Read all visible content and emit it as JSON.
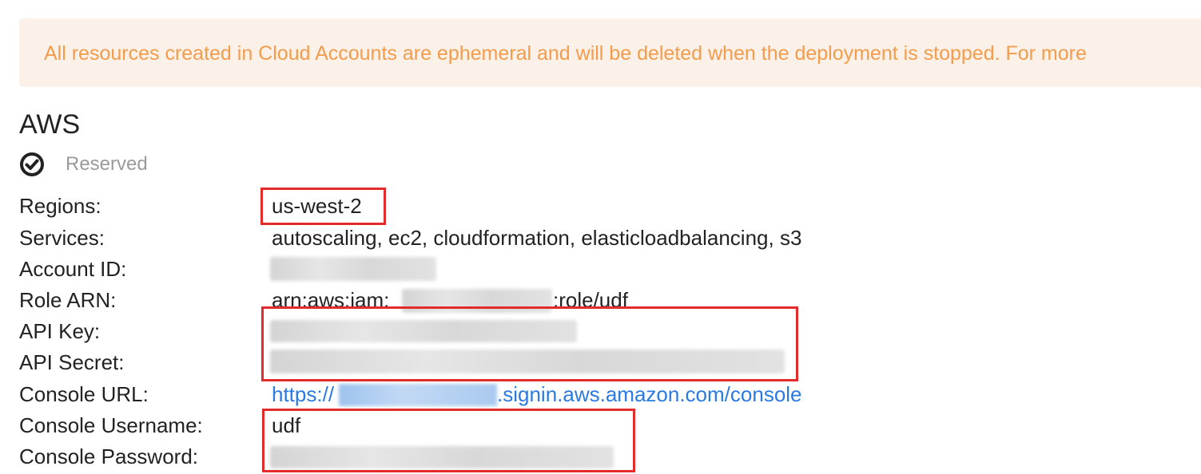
{
  "alert": {
    "text": "All resources created in Cloud Accounts are ephemeral and will be deleted when the deployment is stopped. For more"
  },
  "account": {
    "provider": "AWS",
    "status_icon": "check-circle-icon",
    "status_label": "Reserved"
  },
  "fields": {
    "regions": {
      "label": "Regions:",
      "value": "us-west-2"
    },
    "services": {
      "label": "Services:",
      "value": "autoscaling, ec2, cloudformation, elasticloadbalancing, s3"
    },
    "account_id": {
      "label": "Account ID:"
    },
    "role_arn": {
      "label": "Role ARN:",
      "prefix": "arn:aws:iam:",
      "suffix": ":role/udf"
    },
    "api_key": {
      "label": "API Key:"
    },
    "api_secret": {
      "label": "API Secret:"
    },
    "console_url": {
      "label": "Console URL:",
      "prefix": "https://",
      "suffix": ".signin.aws.amazon.com/console"
    },
    "console_username": {
      "label": "Console Username:",
      "value": "udf"
    },
    "console_password": {
      "label": "Console Password:"
    }
  },
  "colors": {
    "alert_bg": "#fcf1e9",
    "alert_text": "#f39c4c",
    "link": "#2a7ae2",
    "highlight": "#e32b2b"
  }
}
